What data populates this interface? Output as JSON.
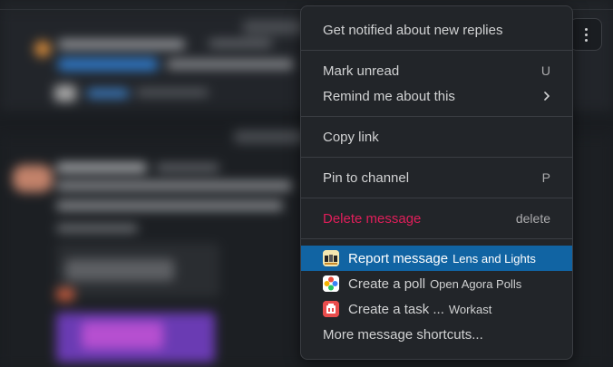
{
  "menu": {
    "items": [
      {
        "label": "Get notified about new replies"
      },
      {
        "label": "Mark unread",
        "shortcut": "U"
      },
      {
        "label": "Remind me about this"
      },
      {
        "label": "Copy link"
      },
      {
        "label": "Pin to channel",
        "shortcut": "P"
      },
      {
        "label": "Delete message",
        "shortcut": "delete"
      },
      {
        "label": "Report message",
        "app": "Lens and Lights",
        "icon": "lens-and-lights-app-icon"
      },
      {
        "label": "Create a poll",
        "app": "Open Agora Polls",
        "icon": "open-agora-polls-app-icon"
      },
      {
        "label": "Create a task ...",
        "app": "Workast",
        "icon": "workast-app-icon"
      },
      {
        "label": "More message shortcuts..."
      }
    ],
    "highlighted_item": "Report message"
  },
  "colors": {
    "menu_background": "#222529",
    "highlight": "#1164a3",
    "danger": "#e01e5a",
    "text": "#d1d2d3"
  },
  "icons": [
    "more-vertical-icon",
    "chevron-right-icon"
  ]
}
